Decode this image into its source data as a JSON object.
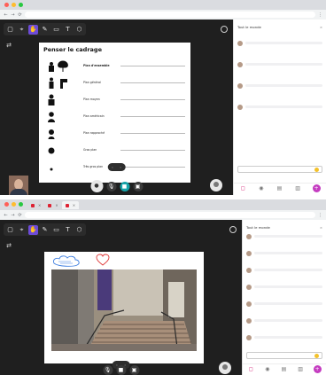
{
  "shot1": {
    "window_controls": {
      "close": "#ff5f57",
      "minimize": "#febc2e",
      "maximize": "#28c840"
    },
    "browser": {
      "tabs": [],
      "url": "",
      "nav": {
        "back": "←",
        "forward": "→",
        "reload": "⟳"
      }
    },
    "toolbar": {
      "tools": [
        {
          "icon": "pointer-icon",
          "glyph": "▢",
          "active": false
        },
        {
          "icon": "select-icon",
          "glyph": "⌖",
          "active": false
        },
        {
          "icon": "hand-icon",
          "glyph": "✋",
          "active": true
        },
        {
          "icon": "pen-icon",
          "glyph": "✎",
          "active": false
        },
        {
          "icon": "eraser-icon",
          "glyph": "▭",
          "active": false
        },
        {
          "icon": "text-icon",
          "glyph": "T",
          "active": false
        },
        {
          "icon": "shapes-icon",
          "glyph": "⬡",
          "active": false
        }
      ],
      "side_glyph": "⇄"
    },
    "slide": {
      "title": "Penser le cadrage",
      "rows": [
        {
          "label": "Plan d'ensemble",
          "bold": true,
          "desc": ""
        },
        {
          "label": "Plan général",
          "bold": false,
          "desc": ""
        },
        {
          "label": "Plan moyen",
          "bold": false,
          "desc": ""
        },
        {
          "label": "Plan américain",
          "bold": false,
          "desc": ""
        },
        {
          "label": "Plan rapproché",
          "bold": false,
          "desc": ""
        },
        {
          "label": "Gros plan",
          "bold": false,
          "desc": ""
        },
        {
          "label": "Très gros plan",
          "bold": false,
          "desc": ""
        }
      ]
    },
    "pager": {
      "prev": "‹",
      "next": "›",
      "label": ""
    },
    "controls": [
      {
        "icon": "user-icon",
        "glyph": "●",
        "style": "main"
      },
      {
        "icon": "microphone-icon",
        "glyph": "🎙",
        "style": "dark"
      },
      {
        "icon": "camera-icon",
        "glyph": "■",
        "style": "teal"
      },
      {
        "icon": "screen-share-icon",
        "glyph": "▣",
        "style": "dark"
      }
    ],
    "chat": {
      "title": "Tout le monde",
      "close": "×",
      "messages": [
        {
          "author": "",
          "time": "",
          "text": ""
        },
        {
          "author": "",
          "time": "",
          "text": ""
        },
        {
          "author": "",
          "time": "",
          "text": ""
        },
        {
          "author": "",
          "time": "",
          "text": ""
        }
      ],
      "input_placeholder": "",
      "tabs": [
        {
          "icon": "chat-icon",
          "glyph": "◻",
          "active": true
        },
        {
          "icon": "participants-icon",
          "glyph": "◉",
          "active": false
        },
        {
          "icon": "notes-icon",
          "glyph": "▤",
          "active": false
        },
        {
          "icon": "files-icon",
          "glyph": "▥",
          "active": false
        },
        {
          "icon": "more-icon",
          "glyph": "+",
          "active": false
        }
      ]
    }
  },
  "shot2": {
    "window_controls": {
      "close": "#ff5f57",
      "minimize": "#febc2e",
      "maximize": "#28c840"
    },
    "browser": {
      "tabs": [
        {
          "title": "",
          "active": false
        },
        {
          "title": "",
          "active": false
        },
        {
          "title": "",
          "active": true
        }
      ],
      "url": "",
      "nav": {
        "back": "←",
        "forward": "→",
        "reload": "⟳"
      }
    },
    "toolbar": {
      "tools": [
        {
          "icon": "pointer-icon",
          "glyph": "▢",
          "active": false
        },
        {
          "icon": "select-icon",
          "glyph": "⌖",
          "active": false
        },
        {
          "icon": "hand-icon",
          "glyph": "✋",
          "active": true
        },
        {
          "icon": "pen-icon",
          "glyph": "✎",
          "active": false
        },
        {
          "icon": "eraser-icon",
          "glyph": "▭",
          "active": false
        },
        {
          "icon": "text-icon",
          "glyph": "T",
          "active": false
        },
        {
          "icon": "shapes-icon",
          "glyph": "⬡",
          "active": false
        }
      ],
      "side_glyph": "⇄"
    },
    "slide": {
      "caption": ""
    },
    "pager": {
      "prev": "‹",
      "next": "›",
      "label": ""
    },
    "controls": [
      {
        "icon": "microphone-icon",
        "glyph": "🎙",
        "style": "dark"
      },
      {
        "icon": "camera-icon",
        "glyph": "■",
        "style": "dark"
      },
      {
        "icon": "screen-share-icon",
        "glyph": "▣",
        "style": "dark"
      }
    ],
    "chat": {
      "title": "Tout le monde",
      "close": "×",
      "messages": [
        {
          "author": "",
          "time": "",
          "text": ""
        },
        {
          "author": "",
          "time": "",
          "text": ""
        },
        {
          "author": "",
          "time": "",
          "text": ""
        },
        {
          "author": "",
          "time": "",
          "text": ""
        },
        {
          "author": "",
          "time": "",
          "text": ""
        },
        {
          "author": "",
          "time": "",
          "text": ""
        },
        {
          "author": "",
          "time": "",
          "text": ""
        }
      ],
      "input_placeholder": "",
      "tabs": [
        {
          "icon": "chat-icon",
          "glyph": "◻",
          "active": true
        },
        {
          "icon": "participants-icon",
          "glyph": "◉",
          "active": false
        },
        {
          "icon": "notes-icon",
          "glyph": "▤",
          "active": false
        },
        {
          "icon": "files-icon",
          "glyph": "▥",
          "active": false
        },
        {
          "icon": "more-icon",
          "glyph": "+",
          "active": false
        }
      ]
    }
  }
}
